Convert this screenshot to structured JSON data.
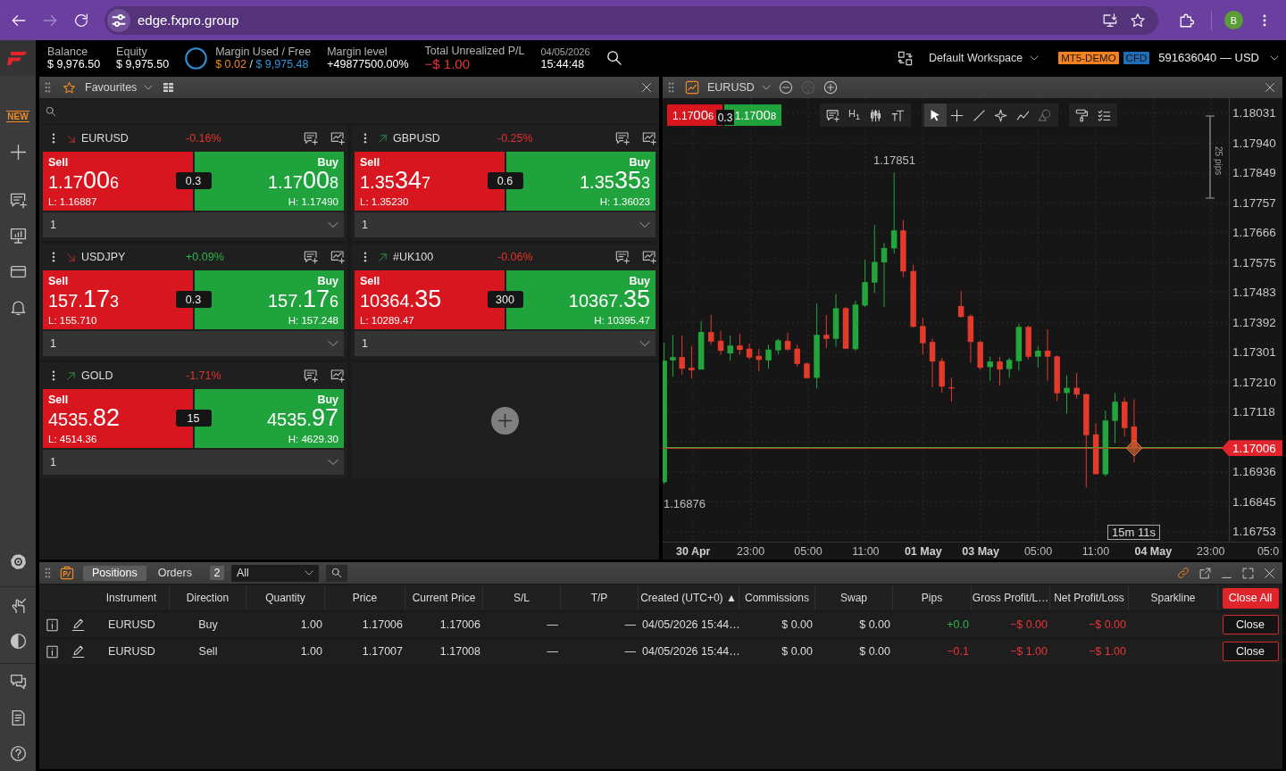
{
  "browser": {
    "nav": [
      {
        "kind": "back",
        "disabled": false
      },
      {
        "kind": "forward",
        "disabled": true
      },
      {
        "kind": "reload",
        "disabled": false
      }
    ],
    "url": "edge.fxpro.group",
    "profile_initial": "B"
  },
  "account_bar": {
    "balance": {
      "label": "Balance",
      "value": "$ 9,976.50"
    },
    "equity": {
      "label": "Equity",
      "value": "$ 9,975.50"
    },
    "margin": {
      "label": "Margin Used / Free",
      "used": "$ 0.02",
      "separator": "/",
      "free": "$ 9,975.48"
    },
    "margin_level": {
      "label": "Margin level",
      "value": "+49877500.00%"
    },
    "unrealized": {
      "label": "Total Unrealized P/L",
      "value": "−$ 1.00"
    },
    "date": "04/05/2026",
    "time": "15:44:48",
    "workspace": "Default Workspace",
    "badges": [
      {
        "text": "MT5-DEMO",
        "color": "#f5821f"
      },
      {
        "text": "CFD",
        "color": "#1e6db5"
      }
    ],
    "account": "591636040 — USD"
  },
  "sidebar": {
    "new_label": "NEW"
  },
  "favourites": {
    "title": "Favourites",
    "cards": [
      {
        "symbol": "EURUSD",
        "rising": false,
        "change": "-0.16%",
        "change_positive": false,
        "sell": {
          "label": "Sell",
          "price": {
            "lead": "1.17",
            "big": "00",
            "pip": "6"
          },
          "extreme": "L: 1.16887"
        },
        "spread": "0.3",
        "buy": {
          "label": "Buy",
          "price": {
            "lead": "1.17",
            "big": "00",
            "pip": "8"
          },
          "extreme": "H: 1.17490"
        },
        "quantity": "1"
      },
      {
        "symbol": "GBPUSD",
        "rising": true,
        "change": "-0.25%",
        "change_positive": false,
        "sell": {
          "label": "Sell",
          "price": {
            "lead": "1.35",
            "big": "34",
            "pip": "7"
          },
          "extreme": "L: 1.35230"
        },
        "spread": "0.6",
        "buy": {
          "label": "Buy",
          "price": {
            "lead": "1.35",
            "big": "35",
            "pip": "3"
          },
          "extreme": "H: 1.36023"
        },
        "quantity": "1"
      },
      {
        "symbol": "USDJPY",
        "rising": false,
        "change": "+0.09%",
        "change_positive": true,
        "sell": {
          "label": "Sell",
          "price": {
            "lead": "157.",
            "big": "17",
            "pip": "3"
          },
          "extreme": "L: 155.710"
        },
        "spread": "0.3",
        "buy": {
          "label": "Buy",
          "price": {
            "lead": "157.",
            "big": "17",
            "pip": "6"
          },
          "extreme": "H: 157.248"
        },
        "quantity": "1"
      },
      {
        "symbol": "#UK100",
        "rising": true,
        "change": "-0.06%",
        "change_positive": false,
        "sell": {
          "label": "Sell",
          "price": {
            "lead": "10364.",
            "big": "35"
          },
          "extreme": "L: 10289.47"
        },
        "spread": "300",
        "buy": {
          "label": "Buy",
          "price": {
            "lead": "10367.",
            "big": "35"
          },
          "extreme": "H: 10395.47"
        },
        "quantity": "1"
      },
      {
        "symbol": "GOLD",
        "rising": true,
        "change": "-1.71%",
        "change_positive": false,
        "sell": {
          "label": "Sell",
          "price": {
            "lead": "4535.",
            "big": "82"
          },
          "extreme": "L: 4514.36"
        },
        "spread": "15",
        "buy": {
          "label": "Buy",
          "price": {
            "lead": "4535.",
            "big": "97"
          },
          "extreme": "H: 4629.30"
        },
        "quantity": "1"
      }
    ]
  },
  "chart_panel": {
    "symbol": "EURUSD",
    "zoom_controls": [
      {
        "kind": "minus",
        "disabled": false
      },
      {
        "kind": "target",
        "disabled": true
      },
      {
        "kind": "plus",
        "disabled": false
      }
    ],
    "quote": {
      "sell": {
        "lead": "1.17",
        "big": "00",
        "pip": "6"
      },
      "spread": "0.3",
      "buy": {
        "lead": "1.17",
        "big": "00",
        "pip": "8"
      }
    },
    "timeframe": "H$_{1}$",
    "tools": [
      {
        "kind": "pointer",
        "selected": true,
        "disabled": false
      },
      {
        "kind": "crosshair",
        "selected": false,
        "disabled": false
      },
      {
        "kind": "line",
        "selected": false,
        "disabled": false
      },
      {
        "kind": "sparkle",
        "selected": false,
        "disabled": false
      },
      {
        "kind": "polyline",
        "selected": false,
        "disabled": false
      },
      {
        "kind": "shapes",
        "selected": false,
        "disabled": true
      }
    ],
    "price_axis": [
      {
        "text": "1.18031",
        "kind": "tick"
      },
      {
        "text": "1.17940",
        "kind": "tick"
      },
      {
        "text": "1.17849",
        "kind": "tick"
      },
      {
        "text": "1.17757",
        "kind": "tick"
      },
      {
        "text": "1.17666",
        "kind": "tick"
      },
      {
        "text": "1.17575",
        "kind": "tick"
      },
      {
        "text": "1.17483",
        "kind": "tick"
      },
      {
        "text": "1.17392",
        "kind": "tick"
      },
      {
        "text": "1.17301",
        "kind": "tick"
      },
      {
        "text": "1.17210",
        "kind": "tick"
      },
      {
        "text": "1.17118",
        "kind": "tick"
      },
      {
        "text": "1.17006",
        "kind": "current"
      },
      {
        "text": "1.16936",
        "kind": "tick"
      },
      {
        "text": "1.16845",
        "kind": "tick"
      },
      {
        "text": "1.16753",
        "kind": "tick"
      }
    ],
    "time_axis": [
      {
        "text": "30 Apr",
        "kind": "date"
      },
      {
        "text": "23:00",
        "kind": "time"
      },
      {
        "text": "05:00",
        "kind": "time"
      },
      {
        "text": "11:00",
        "kind": "time"
      },
      {
        "text": "01 May",
        "kind": "date"
      },
      {
        "text": "03 May",
        "kind": "date"
      },
      {
        "text": "05:00",
        "kind": "time"
      },
      {
        "text": "11:00",
        "kind": "time"
      },
      {
        "text": "04 May",
        "kind": "date"
      },
      {
        "text": "23:00",
        "kind": "time"
      },
      {
        "text": "05:0",
        "kind": "time"
      }
    ],
    "high_label": "1.17851",
    "low_label": "1.16876",
    "countdown": "15m 11s",
    "ruler_label": "25 pips"
  },
  "positions_panel": {
    "tabs": [
      {
        "label": "Positions",
        "selected": true
      },
      {
        "label": "Orders",
        "selected": false
      }
    ],
    "count": "2",
    "filter": "All",
    "columns": [
      "Instrument",
      "Direction",
      "Quantity",
      "Price",
      "Current Price",
      "S/L",
      "T/P",
      "Created (UTC+0) ▲",
      "Commissions",
      "Swap",
      "Pips",
      "Gross Profit/L…",
      "Net Profit/Loss",
      "Sparkline"
    ],
    "close_all": "Close All",
    "rows": [
      {
        "instrument": "EURUSD",
        "direction": "Buy",
        "quantity": "1.00",
        "price": "1.17006",
        "current_price": "1.17006",
        "sl": "—",
        "tp": "—",
        "created": "04/05/2026 15:44…",
        "commissions": "$ 0.00",
        "swap": "$ 0.00",
        "pips": "+0.0",
        "pips_positive": true,
        "gross": "−$ 0.00",
        "net": "−$ 0.00",
        "pl_positive": false,
        "action": "Close"
      },
      {
        "instrument": "EURUSD",
        "direction": "Sell",
        "quantity": "1.00",
        "price": "1.17007",
        "current_price": "1.17008",
        "sl": "—",
        "tp": "—",
        "created": "04/05/2026 15:44…",
        "commissions": "$ 0.00",
        "swap": "$ 0.00",
        "pips": "−0.1",
        "pips_positive": false,
        "gross": "−$ 1.00",
        "net": "−$ 1.00",
        "pl_positive": false,
        "action": "Close"
      }
    ]
  }
}
